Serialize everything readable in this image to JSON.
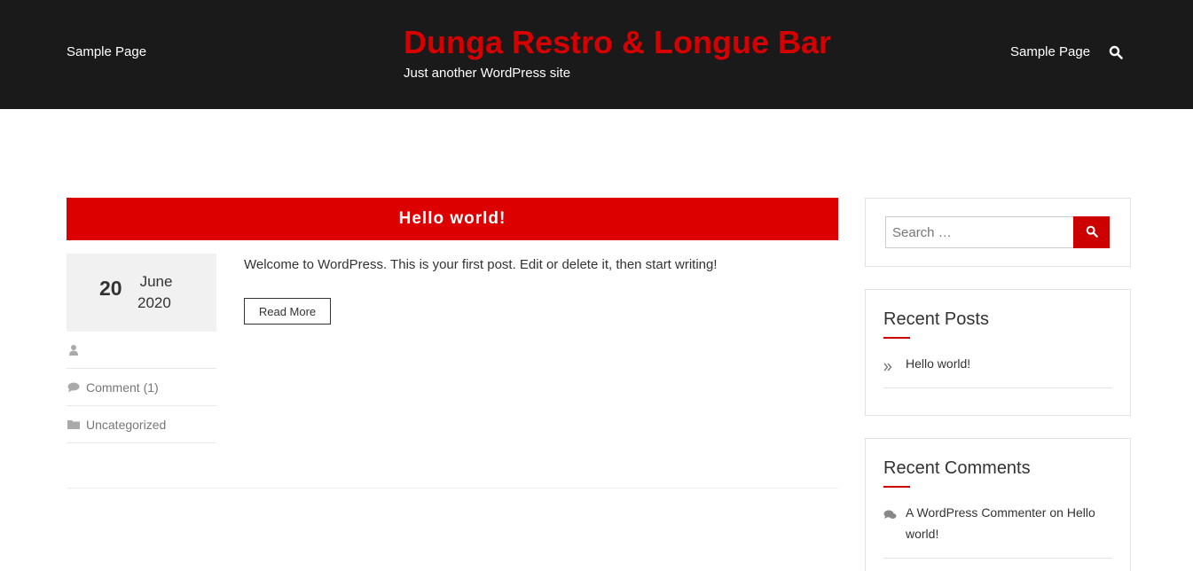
{
  "header": {
    "nav_left": "Sample Page",
    "nav_right": "Sample Page",
    "site_title": "Dunga Restro & Longue Bar",
    "site_description": "Just another WordPress site",
    "search_icon": "search-icon"
  },
  "post": {
    "title": "Hello world!",
    "date_day": "20",
    "date_month": "June",
    "date_year": "2020",
    "excerpt": "Welcome to WordPress. This is your first post. Edit or delete it, then start writing!",
    "read_more": "Read More",
    "meta": {
      "author_icon": "user-icon",
      "author": "",
      "comment_icon": "comment-icon",
      "comments": "Comment (1)",
      "category_icon": "folder-icon",
      "category": "Uncategorized"
    }
  },
  "sidebar": {
    "search": {
      "placeholder": "Search …",
      "submit_icon": "search-icon"
    },
    "recent_posts": {
      "title": "Recent Posts",
      "items": [
        {
          "icon": "double-chevron-right-icon",
          "label": "Hello world!"
        }
      ]
    },
    "recent_comments": {
      "title": "Recent Comments",
      "items": [
        {
          "icon": "comments-icon",
          "author": "A WordPress Commenter",
          "on": "on",
          "post": "Hello world!"
        }
      ]
    }
  },
  "colors": {
    "header_bg": "#1a1a1a",
    "accent": "#dd0000",
    "title_red": "#d60000"
  }
}
